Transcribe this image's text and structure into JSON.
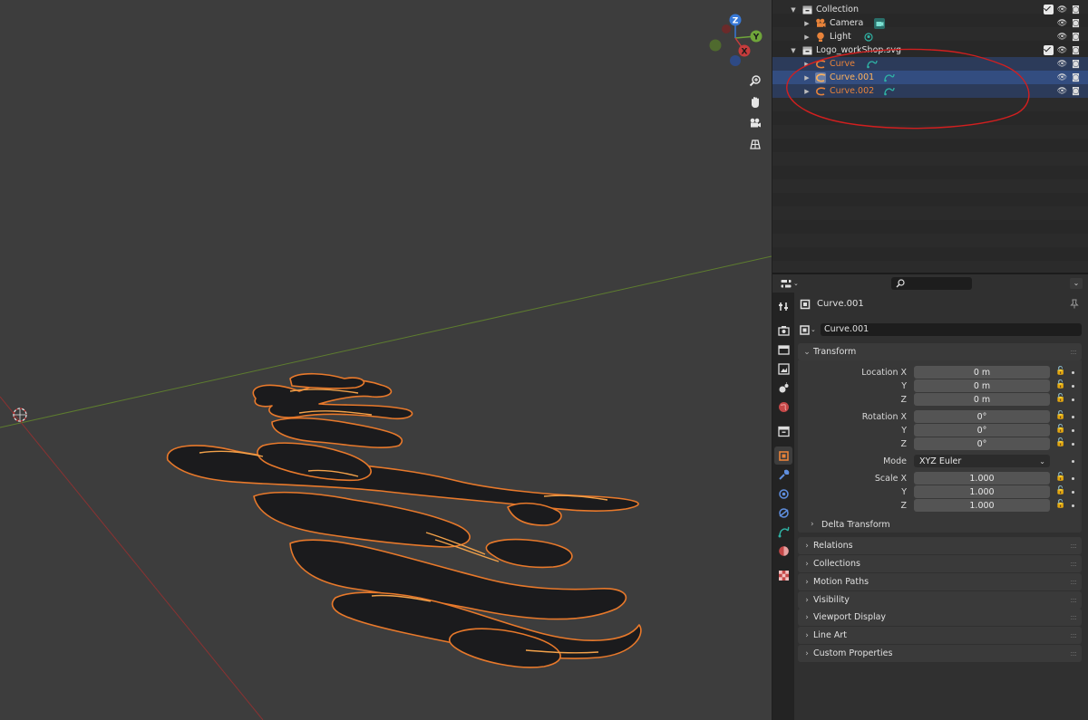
{
  "outliner": {
    "rows": [
      {
        "label": "Collection",
        "type": "collection"
      },
      {
        "label": "Camera",
        "type": "camera"
      },
      {
        "label": "Light",
        "type": "light"
      },
      {
        "label": "Logo_workShop.svg",
        "type": "collection"
      },
      {
        "label": "Curve",
        "type": "curve"
      },
      {
        "label": "Curve.001",
        "type": "curve"
      },
      {
        "label": "Curve.002",
        "type": "curve"
      }
    ]
  },
  "props": {
    "header_title": "Curve.001",
    "object_name": "Curve.001",
    "transform": {
      "title": "Transform",
      "location_label": "Location X",
      "location": [
        "0 m",
        "0 m",
        "0 m"
      ],
      "rotation_label": "Rotation X",
      "rotation": [
        "0°",
        "0°",
        "0°"
      ],
      "mode_label": "Mode",
      "mode_value": "XYZ Euler",
      "scale_label": "Scale X",
      "scale": [
        "1.000",
        "1.000",
        "1.000"
      ],
      "axis_y": "Y",
      "axis_z": "Z"
    },
    "delta_transform": "Delta Transform",
    "panels": [
      "Relations",
      "Collections",
      "Motion Paths",
      "Visibility",
      "Viewport Display",
      "Line Art",
      "Custom Properties"
    ]
  },
  "gizmo": {
    "z": "Z",
    "y": "Y",
    "x": "X"
  },
  "colors": {
    "selected_row": "#334d80",
    "object_orange": "#e8833a",
    "curve_teal": "#2fb3a5",
    "x_axis": "#c63c3c",
    "y_axis": "#6fa53a",
    "z_axis": "#3778d6"
  }
}
